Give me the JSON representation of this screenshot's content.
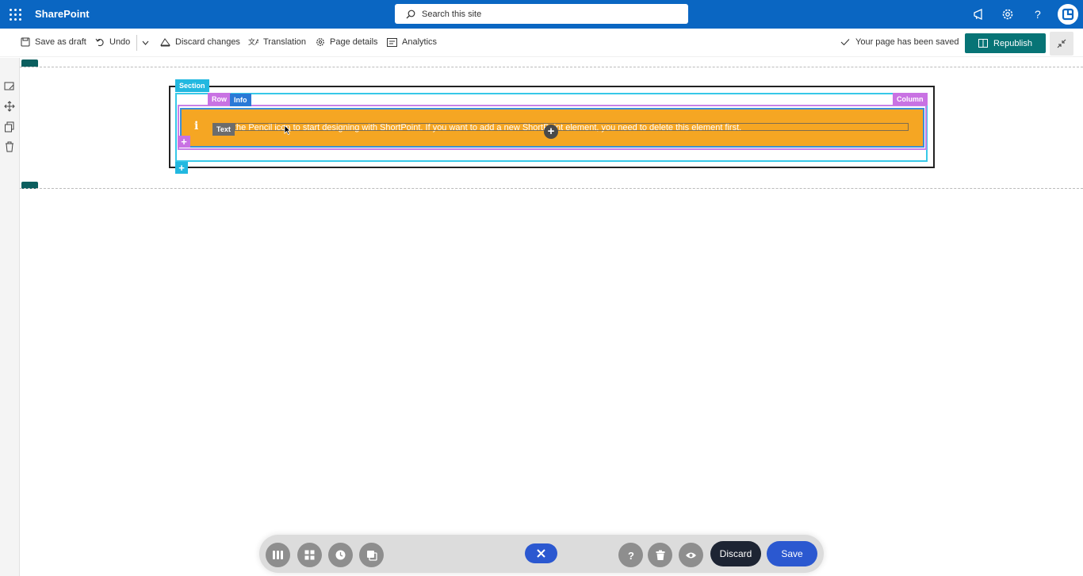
{
  "suite_bar": {
    "app_name": "SharePoint",
    "search_placeholder": "Search this site"
  },
  "command_bar": {
    "save_as_draft": "Save as draft",
    "undo": "Undo",
    "discard_changes": "Discard changes",
    "translation": "Translation",
    "page_details": "Page details",
    "analytics": "Analytics",
    "saved_status": "Your page has been saved",
    "republish": "Republish"
  },
  "canvas": {
    "labels": {
      "section": "Section",
      "row": "Row",
      "info": "Info",
      "column": "Column",
      "text": "Text"
    },
    "info_element": {
      "icon_char": "i",
      "message": "the Pencil icon to start designing with ShortPoint. If you want to add a new ShortPoint element, you need to delete this element first.",
      "background_color": "#f5a623"
    },
    "plus_symbol": "+"
  },
  "bottom_toolbar": {
    "discard": "Discard",
    "save": "Save",
    "tools": [
      "columns-icon",
      "grid-icon",
      "clock-icon",
      "copy-icon"
    ],
    "right_tools": [
      "help-icon",
      "trash-icon",
      "eye-icon"
    ]
  },
  "colors": {
    "suite_bar": "#0a66c2",
    "republish": "#077476",
    "save": "#2b58d0",
    "discard": "#1d2433"
  }
}
